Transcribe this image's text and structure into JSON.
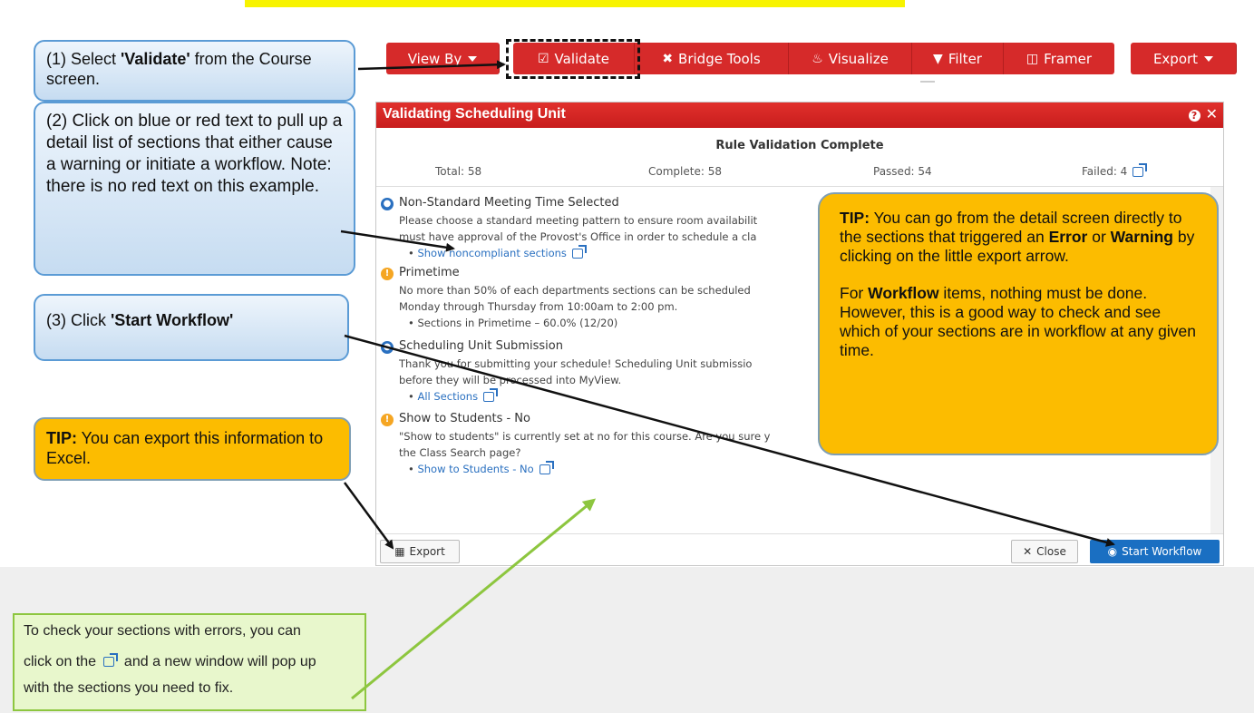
{
  "toolbar": {
    "view_by": "View By",
    "validate": "Validate",
    "bridge_tools": "Bridge Tools",
    "visualize": "Visualize",
    "filter": "Filter",
    "framer": "Framer",
    "export": "Export"
  },
  "callouts": {
    "step1_prefix": "(1) Select ",
    "step1_bold": "'Validate'",
    "step1_suffix": " from the Course screen.",
    "step2": "(2) Click on blue or red text to pull up a detail list of sections that either cause a warning or initiate a workflow. Note: there is no red text on this example.",
    "step3_prefix": "(3) Click ",
    "step3_bold": "'Start Workflow'",
    "tip_export_bold": "TIP:",
    "tip_export_text": " You can export this information to Excel.",
    "tip_detail_bold": "TIP:",
    "tip_detail_1": " You can go from the detail screen directly to the sections that triggered an ",
    "tip_detail_error": "Error",
    "tip_detail_or": " or ",
    "tip_detail_warning": "Warning",
    "tip_detail_2": " by clicking on the little export arrow.",
    "tip_detail_p2_a": "For ",
    "tip_detail_workflow": "Workflow",
    "tip_detail_p2_b": " items, nothing must be done. However, this is a good way to check and see which of your sections are in workflow at any given time."
  },
  "dialog": {
    "title": "Validating Scheduling Unit",
    "heading": "Rule Validation Complete",
    "stats": {
      "total": "Total: 58",
      "complete": "Complete: 58",
      "passed": "Passed: 54",
      "failed": "Failed: 4"
    },
    "issues": [
      {
        "title": "Non-Standard Meeting Time Selected",
        "line1": "Please choose a standard meeting pattern to ensure room availabilit",
        "line2": "must have approval of the Provost's Office in order to schedule a cla",
        "link": "Show noncompliant sections"
      },
      {
        "title": "Primetime",
        "line1": "No more than 50% of each departments sections can be scheduled",
        "line2": "Monday through Thursday from 10:00am to 2:00 pm.",
        "link": "Sections in Primetime – 60.0% (12/20)"
      },
      {
        "title": "Scheduling Unit Submission",
        "line1": "Thank you for submitting your schedule! Scheduling Unit submissio",
        "line2": "before they will be processed into MyView.",
        "link": "All Sections"
      },
      {
        "title": "Show to Students - No",
        "line1": "\"Show to students\" is currently set at no for this course. Are you sure y",
        "line2": "the Class Search page?",
        "link": "Show to Students - No"
      }
    ],
    "export_btn": "Export",
    "close_btn": "Close",
    "start_btn": "Start Workflow"
  },
  "green_note": {
    "line1": "To check your sections with errors, you can",
    "line2a": "click on the ",
    "line2b": " and a new window will pop up",
    "line3": "with the sections you need to fix."
  },
  "colors": {
    "toolbar_red": "#d62a2a",
    "header_red": "#d0211f",
    "link_blue": "#2a70c0",
    "tip_orange": "#fcbc00",
    "callout_border": "#5b9bd5",
    "note_green": "#e8f7cc",
    "start_blue": "#1a6fc2"
  }
}
